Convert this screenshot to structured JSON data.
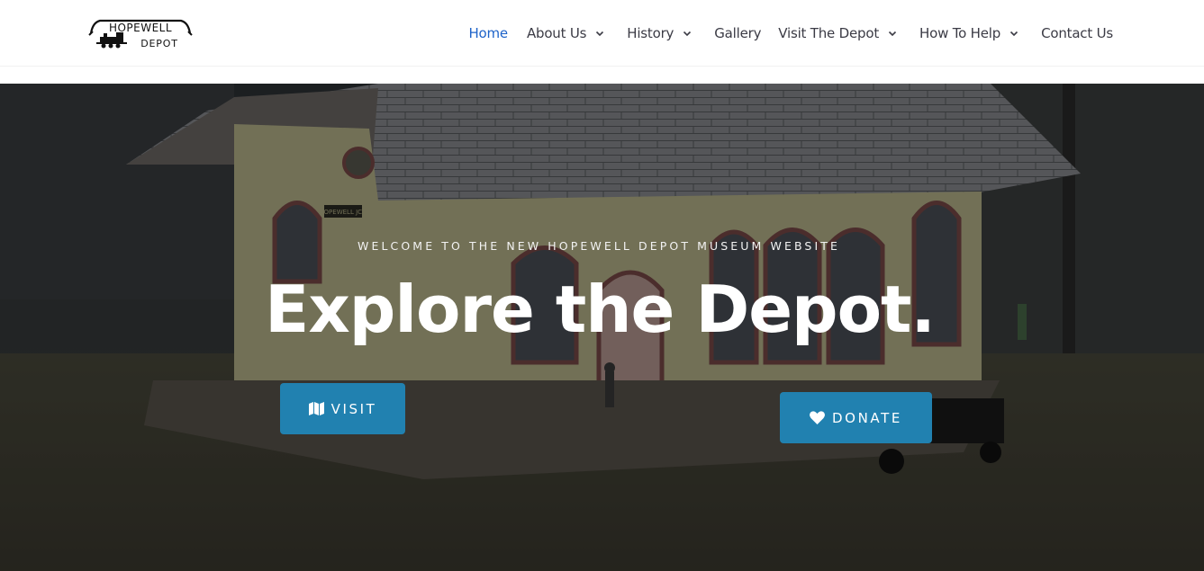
{
  "header": {
    "logo": {
      "alt": "Hopewell Depot logo",
      "line1": "HOPEWELL",
      "line2": "DEPOT"
    },
    "nav": [
      {
        "label": "Home",
        "active": true,
        "has_dropdown": false
      },
      {
        "label": "About Us",
        "active": false,
        "has_dropdown": true
      },
      {
        "label": "History",
        "active": false,
        "has_dropdown": true
      },
      {
        "label": "Gallery",
        "active": false,
        "has_dropdown": false
      },
      {
        "label": "Visit The Depot",
        "active": false,
        "has_dropdown": true
      },
      {
        "label": "How To Help",
        "active": false,
        "has_dropdown": true
      },
      {
        "label": "Contact Us",
        "active": false,
        "has_dropdown": false
      }
    ],
    "colors": {
      "active": "#1e63c9",
      "text": "#3b3b45"
    }
  },
  "hero": {
    "kicker": "WELCOME TO THE NEW HOPEWELL DEPOT MUSEUM WEBSITE",
    "title": "Explore the Depot.",
    "background_alt": "Model railroad depot building labeled Hopewell Jct.",
    "sign_text": "HOPEWELL JCT.",
    "buttons": [
      {
        "label": "VISIT",
        "icon": "map-icon"
      },
      {
        "label": "DONATE",
        "icon": "heart-icon"
      }
    ],
    "button_color": "#2181b0"
  }
}
